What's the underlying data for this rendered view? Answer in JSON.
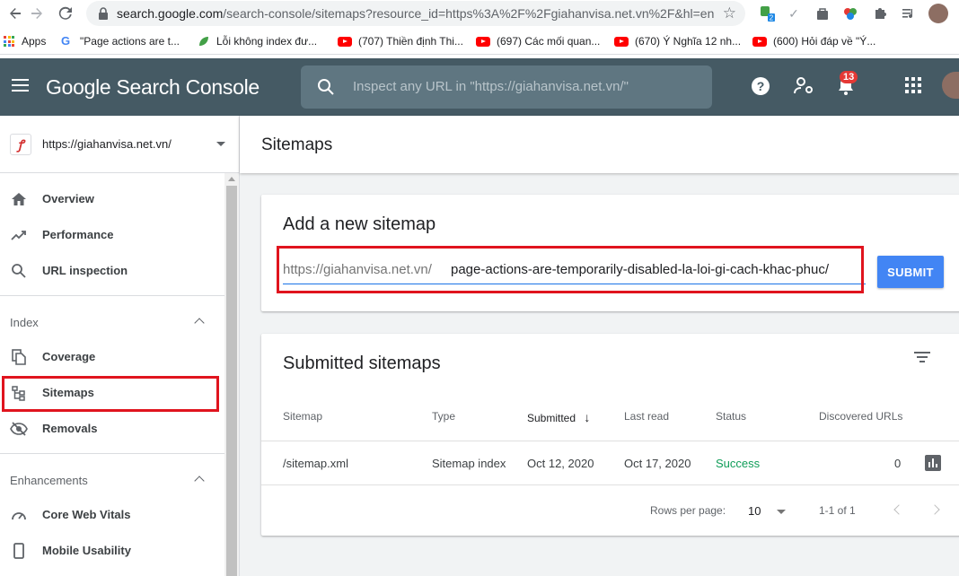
{
  "browser": {
    "url_main": "search.google.com",
    "url_rest": "/search-console/sitemaps?resource_id=https%3A%2F%2Fgiahanvisa.net.vn%2F&hl=en",
    "bookmarks": [
      {
        "label": "Apps"
      },
      {
        "label": "\"Page actions are t..."
      },
      {
        "label": "Lỗi không index đư..."
      },
      {
        "label": "(707) Thiền định Thi..."
      },
      {
        "label": "(697) Các mối quan..."
      },
      {
        "label": "(670) Ý Nghĩa 12 nh..."
      },
      {
        "label": "(600) Hỏi đáp về \"Ý..."
      }
    ],
    "ext_badge": "2"
  },
  "header": {
    "brand": "Google Search Console",
    "search_placeholder": "Inspect any URL in \"https://giahanvisa.net.vn/\"",
    "notification_count": "13"
  },
  "sidebar": {
    "property": "https://giahanvisa.net.vn/",
    "items_top": [
      {
        "label": "Overview",
        "icon": "home-icon"
      },
      {
        "label": "Performance",
        "icon": "trending-up-icon"
      },
      {
        "label": "URL inspection",
        "icon": "search-icon"
      }
    ],
    "index_label": "Index",
    "items_index": [
      {
        "label": "Coverage",
        "icon": "file-copy-icon"
      },
      {
        "label": "Sitemaps",
        "icon": "sitemap-icon"
      },
      {
        "label": "Removals",
        "icon": "visibility-off-icon"
      }
    ],
    "enhancements_label": "Enhancements",
    "items_enh": [
      {
        "label": "Core Web Vitals",
        "icon": "speed-icon"
      },
      {
        "label": "Mobile Usability",
        "icon": "smartphone-icon"
      }
    ]
  },
  "main": {
    "title": "Sitemaps",
    "add_card": {
      "title": "Add a new sitemap",
      "prefix": "https://giahanvisa.net.vn/",
      "value": "page-actions-are-temporarily-disabled-la-loi-gi-cach-khac-phuc/",
      "submit": "SUBMIT"
    },
    "submitted_card": {
      "title": "Submitted sitemaps",
      "columns": [
        "Sitemap",
        "Type",
        "Submitted",
        "Last read",
        "Status",
        "Discovered URLs"
      ],
      "sort_arrow": "↓",
      "rows": [
        {
          "sitemap": "/sitemap.xml",
          "type": "Sitemap index",
          "submitted": "Oct 12, 2020",
          "last_read": "Oct 17, 2020",
          "status": "Success",
          "discovered": "0"
        }
      ],
      "rows_per_page_label": "Rows per page:",
      "rows_per_page": "10",
      "range": "1-1 of 1"
    }
  },
  "colors": {
    "header_bg": "#455a64",
    "accent": "#4285f4",
    "success": "#0f9d58",
    "highlight": "#e0141e"
  }
}
